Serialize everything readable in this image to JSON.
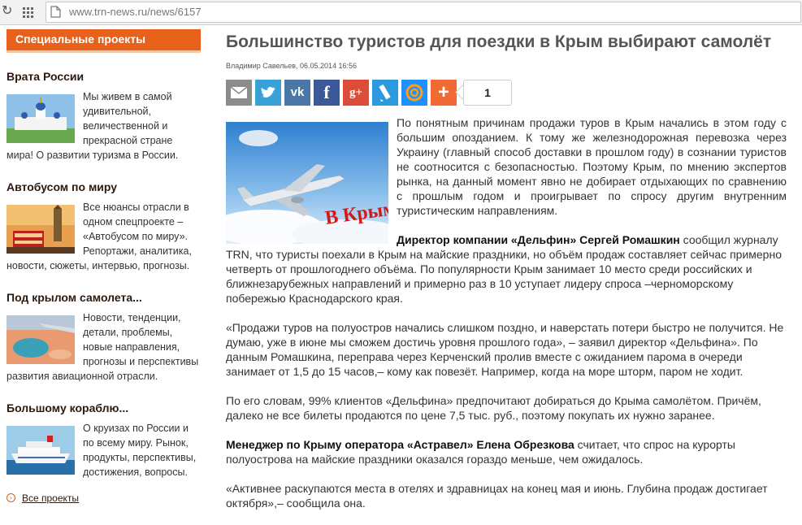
{
  "browser": {
    "url": "www.trn-news.ru/news/6157"
  },
  "sidebar": {
    "header": "Специальные проекты",
    "projects": [
      {
        "title": "Врата России",
        "text": "Мы живем в самой удивительной, величественной и прекрасной стране мира! О развитии туризма в России."
      },
      {
        "title": "Автобусом по миру",
        "text": "Все нюансы отрасли в одном спецпроекте – «Автобусом по миру». Репортажи, аналитика, новости, сюжеты, интервью, прогнозы."
      },
      {
        "title": "Под крылом самолета...",
        "text": "Новости, тенденции, детали, проблемы, новые направления, прогнозы и перспективы развития авиационной отрасли."
      },
      {
        "title": "Большому кораблю...",
        "text": "О круизах по России и по всему миру. Рынок, продукты, перспективы, достижения, вопросы."
      }
    ],
    "all_link": "Все проекты"
  },
  "article": {
    "title": "Большинство туристов для поездки в Крым выбирают самолёт",
    "byline": "Владимир Савельев, 06.05.2014 16:56",
    "image_caption": "В Крым!",
    "share_count": "1",
    "lead": "По понятным причинам продажи туров в Крым начались в этом году с большим опозданием. К тому же железнодорожная перевозка через Украину (главный способ доставки в прошлом году) в сознании туристов не соотносится с безопасностью. Поэтому Крым, по мнению экспертов рынка, на данный момент явно не добирает отдыхающих по сравнению с прошлым годом и проигрывает по спросу другим внутренним туристическим направлениям.",
    "p2_bold": "Директор компании «Дельфин» Сергей Ромашкин",
    "p2_rest": " сообщил журналу TRN, что туристы поехали в Крым на майские праздники, но объём продаж составляет сейчас примерно четверть от прошлогоднего объёма. По популярности Крым занимает 10 место среди российских и ближнезарубежных направлений и примерно раз в 10 уступает лидеру спроса –черноморскому побережью Краснодарского края.",
    "p3": "«Продажи туров на полуостров начались слишком поздно, и наверстать потери быстро не получится. Не думаю, уже в июне мы сможем достичь уровня прошлого года», – заявил директор «Дельфина». По данным Ромашкина, переправа через Керченский пролив вместе с ожиданием парома в очереди занимает от 1,5 до 15 часов,– кому как повезёт. Например, когда на море шторм, паром не ходит.",
    "p4": "По его словам, 99% клиентов «Дельфина» предпочитают добираться до Крыма самолётом. Причём, далеко не все билеты продаются по цене 7,5 тыс. руб., поэтому покупать их нужно заранее.",
    "p5_bold": "Менеджер по Крыму оператора «Астравел» Елена Обрезкова",
    "p5_rest": " считает, что спрос на курорты полуострова на майские праздники оказался гораздо меньше, чем ожидалось.",
    "p6": "«Активнее раскупаются места в отелях и здравницах на конец мая и июнь. Глубина продаж достигает октября»,– сообщила она."
  },
  "share_buttons": [
    {
      "name": "email",
      "color": "#8c8c8c"
    },
    {
      "name": "twitter",
      "color": "#3aa1d8"
    },
    {
      "name": "vk",
      "color": "#4a76a8"
    },
    {
      "name": "facebook",
      "color": "#3b5998"
    },
    {
      "name": "google-plus",
      "color": "#dd4b39"
    },
    {
      "name": "livejournal",
      "color": "#2d9ae0"
    },
    {
      "name": "mail-ru",
      "color": "#1e90ff"
    },
    {
      "name": "more",
      "color": "#f06a35"
    }
  ]
}
